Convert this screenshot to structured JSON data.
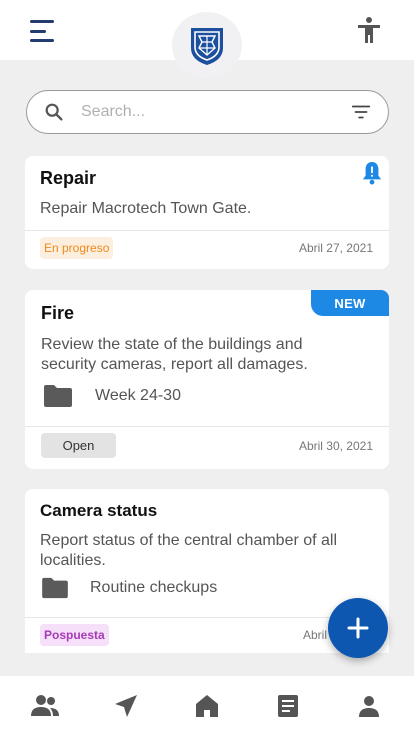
{
  "header": {
    "menu_icon": "menu-icon",
    "logo_icon": "shield-logo",
    "accessibility_icon": "accessibility-icon",
    "brand_color": "#1d4f9f"
  },
  "search": {
    "placeholder": "Search...",
    "value": "",
    "search_icon": "search-icon",
    "filter_icon": "filter-icon"
  },
  "cards": [
    {
      "title": "Repair",
      "description": "Repair Macrotech Town Gate.",
      "status": "En progreso",
      "status_color": "#f0891a",
      "status_bg": "#fdefe0",
      "date": "Abril 27, 2021",
      "indicator_icon": "bell-alert-icon"
    },
    {
      "title": "Fire",
      "description": "Review the state of the buildings and security cameras, report all damages.",
      "folder": "Week 24-30",
      "status": "Open",
      "status_color": "#333333",
      "status_bg": "#e3e3e3",
      "date": "Abril 30, 2021",
      "tag": "NEW"
    },
    {
      "title": "Camera status",
      "description": "Report status of the central chamber of all localities.",
      "folder": "Routine checkups",
      "status": "Pospuesta",
      "status_color": "#a63bb8",
      "status_bg": "#f6dff8",
      "date": "Abril 2"
    }
  ],
  "fab": {
    "icon": "plus-icon",
    "color": "#0d57b0"
  },
  "bottom_nav": [
    {
      "icon": "people-icon"
    },
    {
      "icon": "navigation-icon"
    },
    {
      "icon": "home-icon"
    },
    {
      "icon": "document-icon"
    },
    {
      "icon": "person-icon"
    }
  ]
}
